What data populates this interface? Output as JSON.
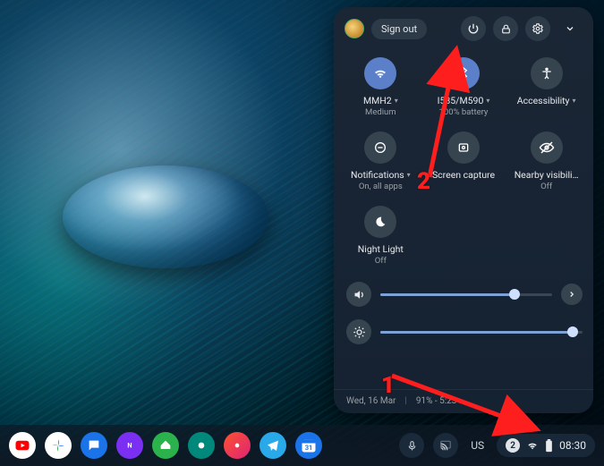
{
  "header": {
    "signout_label": "Sign out"
  },
  "tiles": {
    "wifi": {
      "label": "MMH2",
      "sub": "Medium",
      "has_caret": true
    },
    "bluetooth": {
      "label": "I585/M590",
      "sub": "100% battery",
      "has_caret": true
    },
    "accessibility": {
      "label": "Accessibility",
      "sub": "",
      "has_caret": true
    },
    "notifications": {
      "label": "Notifications",
      "sub": "On, all apps",
      "has_caret": true
    },
    "capture": {
      "label": "Screen capture",
      "sub": ""
    },
    "nearby": {
      "label": "Nearby visibili…",
      "sub": "Off"
    },
    "nightlight": {
      "label": "Night Light",
      "sub": "Off"
    }
  },
  "sliders": {
    "volume_pct": 78,
    "brightness_pct": 95
  },
  "footer": {
    "date": "Wed, 16 Mar",
    "battery": "91% - 5:23 …"
  },
  "shelf": {
    "lang": "US",
    "notif_count": "2",
    "clock": "08:30"
  },
  "annotations": {
    "n1": "1",
    "n2": "2"
  }
}
